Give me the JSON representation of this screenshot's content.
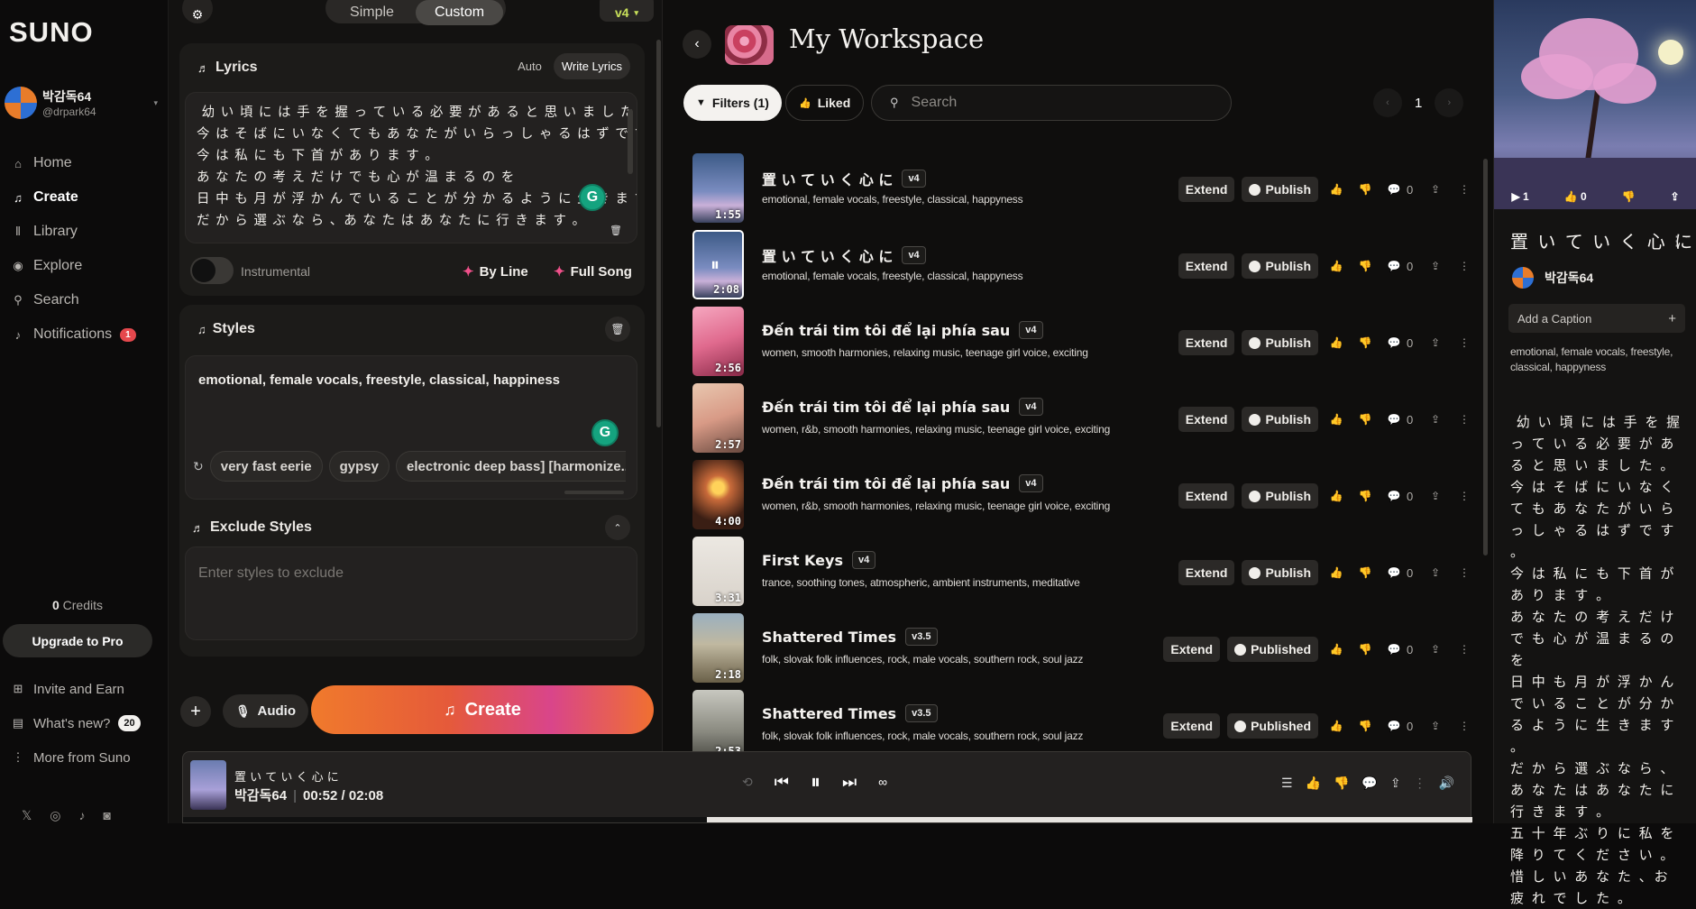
{
  "app": {
    "logo": "SUNO"
  },
  "user": {
    "name": "박감독64",
    "handle": "@drpark64"
  },
  "nav": {
    "items": [
      {
        "label": "Home",
        "icon": "home-icon"
      },
      {
        "label": "Create",
        "icon": "create-icon",
        "active": true
      },
      {
        "label": "Library",
        "icon": "library-icon"
      },
      {
        "label": "Explore",
        "icon": "explore-icon"
      },
      {
        "label": "Search",
        "icon": "search-icon"
      },
      {
        "label": "Notifications",
        "icon": "bell-icon",
        "badge": "1"
      }
    ],
    "credits_value": "0",
    "credits_label": "Credits",
    "upgrade_label": "Upgrade to Pro",
    "bottom": [
      {
        "label": "Invite and Earn",
        "icon": "gift-icon"
      },
      {
        "label": "What's new?",
        "icon": "news-icon",
        "badge": "20"
      },
      {
        "label": "More from Suno",
        "icon": "more-icon"
      }
    ]
  },
  "create": {
    "modes": [
      "Simple",
      "Custom"
    ],
    "active_mode": "Custom",
    "model": "v4",
    "lyrics": {
      "title": "Lyrics",
      "toggle": [
        "Auto",
        "Write Lyrics"
      ],
      "text": " 幼 い 頃 に は 手 を 握 っ て い る 必 要 が あ る と 思 い ま し た 。\n今 は そ ば に い な く て も あ な た が い ら っ し ゃ る は ず で す 。\n今 は 私 に も 下 首 が あ り ま す 。\nあ な た の 考 え だ け で も 心 が 温 ま る の を\n日 中 も 月 が 浮 か ん で い る こ と が 分 か る よ う に 生 き ま す 。\nだ か ら 選 ぶ な ら 、あ な た は あ な た に 行 き ま す 。",
      "instrumental_label": "Instrumental",
      "by_line": "By Line",
      "full_song": "Full Song"
    },
    "styles": {
      "title": "Styles",
      "value": "emotional, female vocals, freestyle, classical, happiness",
      "chips": [
        "very fast eerie",
        "gypsy",
        "electronic deep bass] [harmonize..."
      ]
    },
    "exclude": {
      "title": "Exclude Styles",
      "placeholder": "Enter styles to exclude"
    },
    "audio_label": "Audio",
    "create_label": "Create"
  },
  "workspace": {
    "title": "My Workspace",
    "filters_label": "Filters (1)",
    "liked_label": "Liked",
    "search_placeholder": "Search",
    "page": "1",
    "songs": [
      {
        "title": "置 い て い く 心 に",
        "version": "v4",
        "tags": "emotional, female vocals, freestyle, classical, happyness",
        "duration": "1:55",
        "publish": "Publish",
        "extend": "Extend",
        "count": "0",
        "art": "blossom"
      },
      {
        "title": "置 い て い く 心 に",
        "version": "v4",
        "tags": "emotional, female vocals, freestyle, classical, happyness",
        "duration": "2:08",
        "publish": "Publish",
        "extend": "Extend",
        "count": "0",
        "art": "blossom",
        "playing": true
      },
      {
        "title": "Đến trái tim tôi để lại phía sau",
        "version": "v4",
        "tags": "women, smooth harmonies, relaxing music, teenage girl voice, exciting",
        "duration": "2:56",
        "publish": "Publish",
        "extend": "Extend",
        "count": "0",
        "art": "pink-room"
      },
      {
        "title": "Đến trái tim tôi để lại phía sau",
        "version": "v4",
        "tags": "women, r&b, smooth harmonies, relaxing music, teenage girl voice, exciting",
        "duration": "2:57",
        "publish": "Publish",
        "extend": "Extend",
        "count": "0",
        "art": "heart-window"
      },
      {
        "title": "Đến trái tim tôi để lại phía sau",
        "version": "v4",
        "tags": "women, r&b, smooth harmonies, relaxing music, teenage girl voice, exciting",
        "duration": "4:00",
        "publish": "Publish",
        "extend": "Extend",
        "count": "0",
        "art": "heart-glow"
      },
      {
        "title": "First Keys",
        "version": "v4",
        "tags": "trance, soothing tones, atmospheric, ambient instruments, meditative",
        "duration": "3:31",
        "publish": "Publish",
        "extend": "Extend",
        "count": "0",
        "art": "keys"
      },
      {
        "title": "Shattered Times",
        "version": "v3.5",
        "tags": "folk, slovak folk influences, rock, male vocals, southern rock, soul jazz",
        "duration": "2:18",
        "publish": "Published",
        "extend": "Extend",
        "count": "0",
        "art": "road"
      },
      {
        "title": "Shattered Times",
        "version": "v3.5",
        "tags": "folk, slovak folk influences, rock, male vocals, southern rock, soul jazz",
        "duration": "2:53",
        "publish": "Published",
        "extend": "Extend",
        "count": "0",
        "art": "tree"
      }
    ]
  },
  "player": {
    "title": "置 い て い く 心 に",
    "artist": "박감독64",
    "time": "00:52 / 02:08",
    "progress_fraction": 0.406
  },
  "detail": {
    "play_count": "1",
    "like_count": "0",
    "title": "置 い て い く 心 に",
    "user": "박감독64",
    "caption_label": "Add a Caption",
    "tags": "emotional, female vocals, freestyle, classical, happyness",
    "lyrics": " 幼 い 頃 に は 手 を 握 っ て い る 必 要 が あ る と 思 い ま し た 。\n今 は そ ば に い な く て も あ な た が い ら っ し ゃ る は ず で す 。\n今 は 私 に も 下 首 が あ り ま す 。\nあ な た の 考 え だ け で も 心 が 温 ま る の を\n日 中 も 月 が 浮 か ん で い る こ と が 分 か る よ う に 生 き ま す 。\nだ か ら 選 ぶ な ら 、あ な た は あ な た に 行 き ま す 。\n五 十 年 ぶ り に 私 を 降 り て く だ さ い 。\n惜 し い あ な た 、お 疲 れ で し た 。"
  },
  "colors": {
    "accent_pink": "#f0508a",
    "model_green": "#c8e05a",
    "badge_red": "#e5484d"
  }
}
